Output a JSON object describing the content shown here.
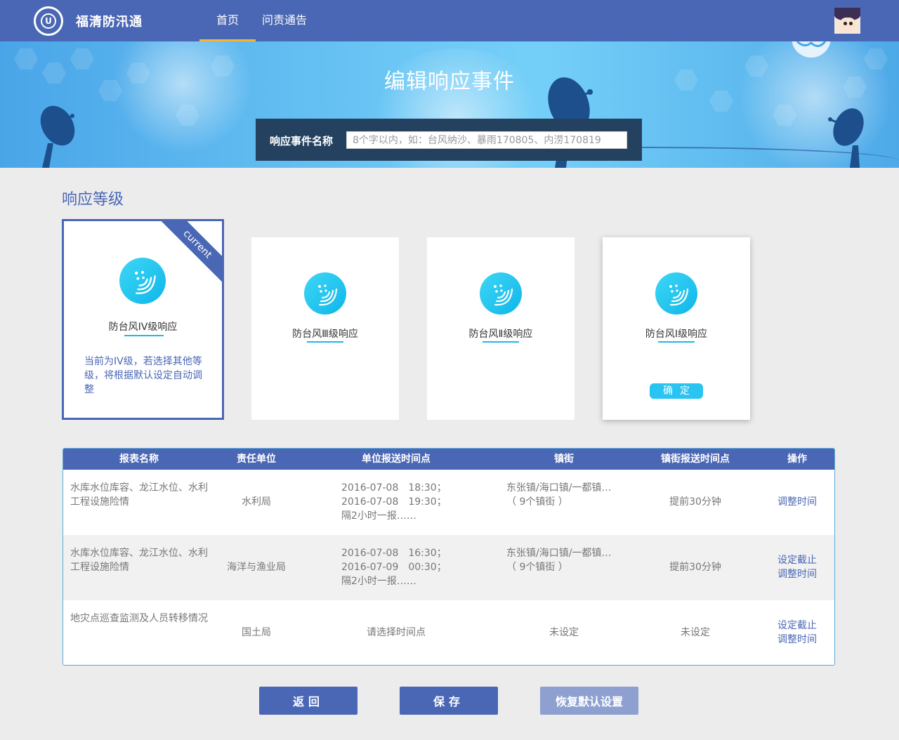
{
  "nav": {
    "brand": "福清防汛通",
    "items": [
      "首页",
      "问责通告"
    ]
  },
  "banner": {
    "title": "编辑响应事件",
    "name_label": "响应事件名称",
    "name_placeholder": "8个字以内，如：台风纳沙、暴雨170805、内涝170819"
  },
  "level": {
    "section_title": "响应等级",
    "ribbon": "current",
    "cards": [
      {
        "name": "防台风IV级响应",
        "desc": "当前为IV级，若选择其他等级，将根据默认设定自动调整"
      },
      {
        "name": "防台风Ⅲ级响应"
      },
      {
        "name": "防台风Ⅱ级响应"
      },
      {
        "name": "防台风Ⅰ级响应",
        "button": "确定"
      }
    ]
  },
  "table": {
    "headers": [
      "报表名称",
      "责任单位",
      "单位报送时间点",
      "镇街",
      "镇街报送时间点",
      "操作"
    ],
    "rows": [
      {
        "name": "水库水位库容、龙江水位、水利工程设施险情",
        "unit": "水利局",
        "time": [
          "2016-07-08　18:30；",
          "2016-07-08　19:30；",
          "隔2小时一报……"
        ],
        "town": [
          "东张镇/海口镇/一都镇…",
          "（ 9个镇街 ）"
        ],
        "before": "提前30分钟",
        "ops": [
          "调整时间"
        ]
      },
      {
        "name": "水库水位库容、龙江水位、水利工程设施险情",
        "unit": "海洋与渔业局",
        "time": [
          "2016-07-08　16:30；",
          "2016-07-09　00:30；",
          "隔2小时一报……"
        ],
        "town": [
          "东张镇/海口镇/一都镇…",
          "（ 9个镇街 ）"
        ],
        "before": "提前30分钟",
        "ops": [
          "设定截止",
          "调整时间"
        ]
      },
      {
        "name": "地灾点巡查监测及人员转移情况",
        "unit": "国土局",
        "time": [
          "请选择时间点"
        ],
        "town": [
          "未设定"
        ],
        "before": "未设定",
        "ops": [
          "设定截止",
          "调整时间"
        ]
      }
    ]
  },
  "buttons": {
    "back": "返回",
    "save": "保存",
    "reset": "恢复默认设置"
  },
  "colors": {
    "primary": "#4a67b5",
    "accent": "#29c4f2",
    "nav_underline": "#f2b632"
  }
}
